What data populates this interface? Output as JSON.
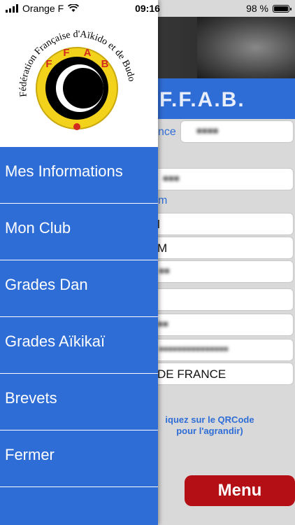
{
  "status_bar": {
    "carrier": "Orange F",
    "time": "09:16",
    "battery_percent": "98 %"
  },
  "logo": {
    "arc_text": "Fédération Française d'Aïkido et de Budo",
    "letters": [
      "F",
      "F",
      "A",
      "B"
    ],
    "colors": {
      "ring": "#f2d21b",
      "red": "#d22a1f",
      "black": "#000000"
    }
  },
  "drawer": {
    "items": [
      {
        "label": "Mes Informations"
      },
      {
        "label": "Mon Club"
      },
      {
        "label": "Grades Dan"
      },
      {
        "label": "Grades Aïkikaï"
      },
      {
        "label": "Brevets"
      },
      {
        "label": "Fermer"
      }
    ],
    "background_color": "#2f6dd6"
  },
  "background": {
    "title": "F.F.A.B.",
    "license_label_partial": "nce",
    "section_label_partial": "m",
    "country_value_partial": "DE FRANCE",
    "line_m": "M",
    "line_l": "l",
    "qr_note": "iquez sur le QRCode pour l'agrandir)",
    "menu_button_label": "Menu",
    "menu_button_color": "#b30f14"
  }
}
